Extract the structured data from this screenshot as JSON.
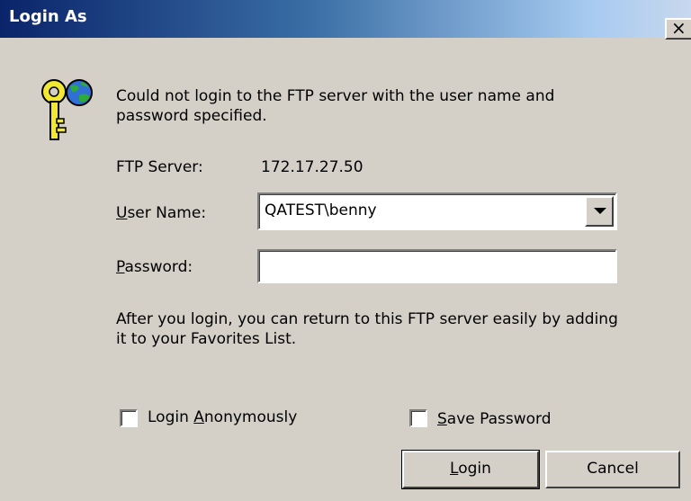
{
  "window": {
    "title": "Login As",
    "close_glyph": "×"
  },
  "message": "Could not login to the FTP server with the user name and password specified.",
  "ftp_server": {
    "label": "FTP Server:",
    "value": "172.17.27.50"
  },
  "user_name": {
    "label_mnemonic": "U",
    "label_rest": "ser Name:",
    "value": "QATEST\\benny"
  },
  "password": {
    "label_mnemonic": "P",
    "label_rest": "assword:",
    "value": ""
  },
  "info": "After you login, you can return to this FTP server easily by adding it to your Favorites List.",
  "login_anonymously": {
    "label_prefix": "Login ",
    "label_mnemonic": "A",
    "label_rest": "nonymously",
    "checked": false
  },
  "save_password": {
    "label_mnemonic": "S",
    "label_rest": "ave Password",
    "checked": false
  },
  "buttons": {
    "login_mnemonic": "L",
    "login_rest": "ogin",
    "cancel": "Cancel"
  },
  "icons": {
    "dialog_icon": "keys-globe-icon",
    "dropdown": "chevron-down-icon"
  }
}
